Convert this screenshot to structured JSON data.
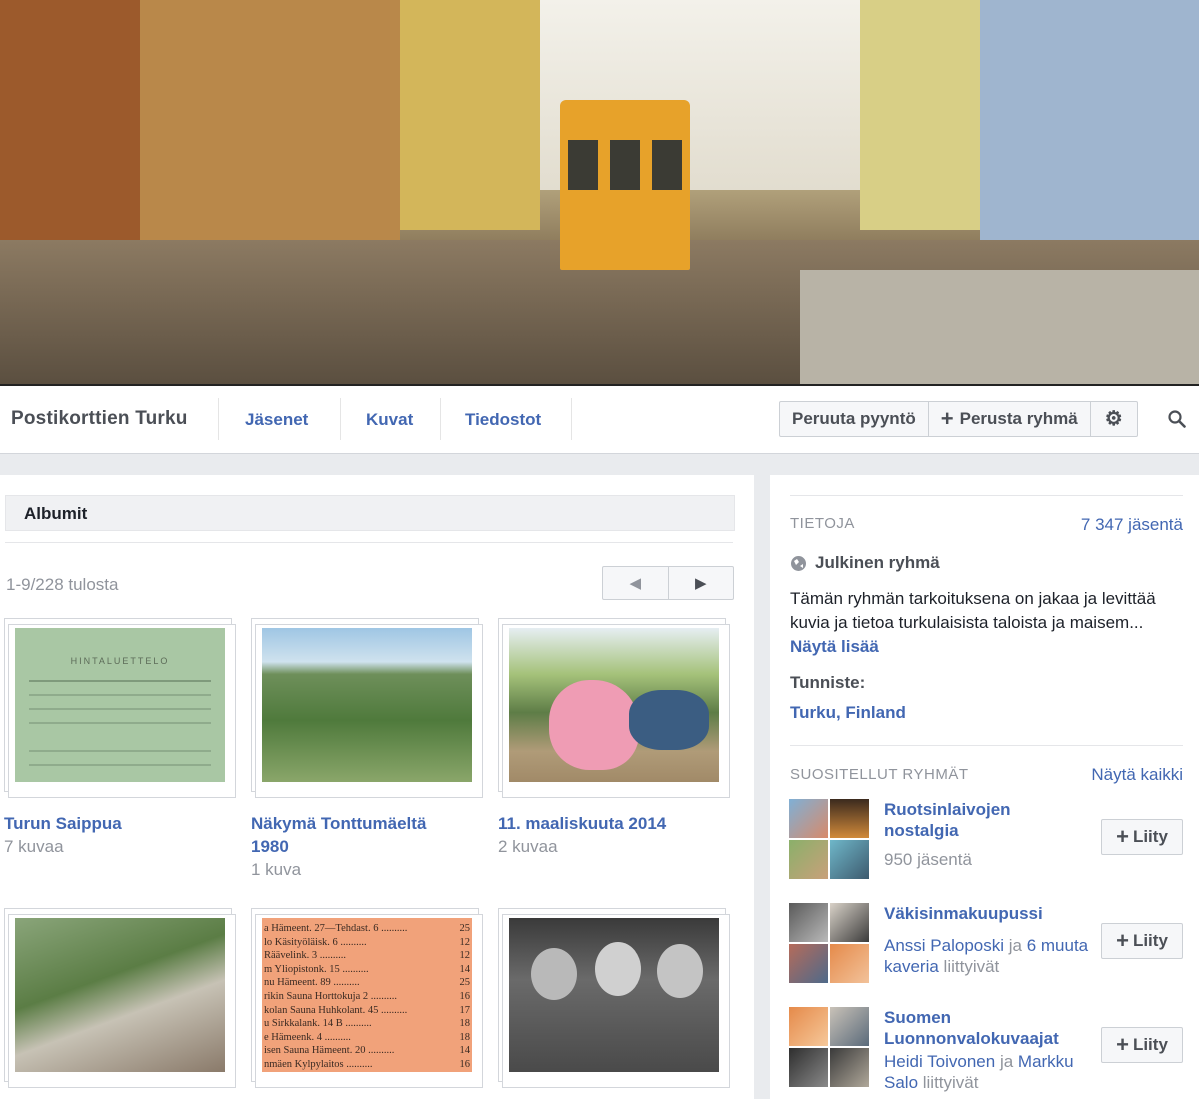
{
  "cover": {
    "alt": "Colorized postcard of a Turku street with a tram"
  },
  "nav": {
    "group_name": "Postikorttien Turku",
    "links": [
      "Jäsenet",
      "Kuvat",
      "Tiedostot"
    ],
    "cancel_request": "Peruuta pyyntö",
    "create_group": "Perusta ryhmä"
  },
  "albums": {
    "header": "Albumit",
    "count": "1-9/228 tulosta",
    "items": [
      {
        "title": "Turun Saippua",
        "count": "7 kuvaa"
      },
      {
        "title": "Näkymä Tonttumäeltä 1980",
        "count": "1 kuva"
      },
      {
        "title": "11. maaliskuuta 2014",
        "count": "2 kuvaa"
      }
    ],
    "row2_texts": {
      "doc_lines": [
        "a Hämeent. 27—Tehdast. 6",
        "lo Käsityöläisk. 6",
        "Räävelink. 3",
        "m Yliopistonk. 15",
        "nu Hämeent. 89",
        "rikin Sauna Horttokuja 2",
        "kolan Sauna Huhkolant. 45",
        "u Sirkkalank. 14 B",
        "e Hämeenk. 4",
        "isen Sauna Hämeent. 20",
        "nmäen Kylpylaitos"
      ],
      "doc_nums": [
        "25",
        "12",
        "12",
        "14",
        "25",
        "16",
        "17",
        "18",
        "18",
        "14",
        "16"
      ]
    },
    "soap_doc_title": "HINTALUETTELO"
  },
  "about": {
    "label": "TIETOJA",
    "members": "7 347 jäsentä",
    "privacy": "Julkinen ryhmä",
    "description": "Tämän ryhmän tarkoituksena on jakaa ja levittää kuvia ja tietoa turkulaisista taloista ja maisem...",
    "see_more": "Näytä lisää",
    "tag_label": "Tunniste:",
    "tag": "Turku, Finland"
  },
  "suggested": {
    "label": "SUOSITELLUT RYHMÄT",
    "see_all": "Näytä kaikki",
    "join_label": "Liity",
    "groups": [
      {
        "name": "Ruotsinlaivojen nostalgia",
        "sub": "950 jäsentä"
      },
      {
        "name": "Väkisinmakuupussi",
        "sub_link": "Anssi Paloposki",
        "sub_mid": " ja ",
        "sub_link2": "6 muuta kaveria",
        "sub_end": " liittyivät"
      },
      {
        "name": "Suomen Luonnonvalokuvaajat",
        "sub_link": "Heidi Toivonen",
        "sub_mid": " ja ",
        "sub_link2": "Markku Salo",
        "sub_end": " liittyivät"
      }
    ]
  }
}
